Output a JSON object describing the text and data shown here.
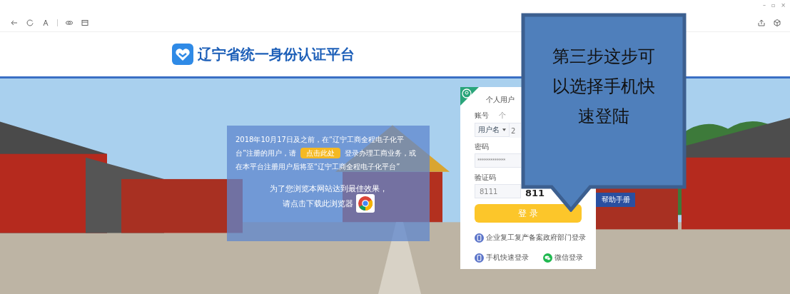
{
  "browser": {
    "window_controls": [
      "–",
      "▫",
      "×"
    ]
  },
  "header": {
    "title": "辽宁省统一身份认证平台"
  },
  "notice": {
    "text_before": "2018年10月17日及之前，在“辽宁工商全程电子化平台”注册的用户，请",
    "link": "点击此处",
    "text_after": "登录办理工商业务，或在本平台注册用户后将至“辽宁工商全程电子化平台”",
    "browser_tip": "为了您浏览本网站达到最佳效果，",
    "download_tip": "请点击下载此浏览器"
  },
  "login": {
    "tabs": [
      {
        "label": "个人用户",
        "selected": true
      }
    ],
    "account_label": "账号",
    "account_hint": "个",
    "account_type": "用户名",
    "username_placeholder": "2",
    "password_label": "密码",
    "password_value": "*************",
    "captcha_label": "验证码",
    "captcha_value": "8111",
    "captcha_image": "811",
    "submit": "登 录",
    "links": [
      {
        "label": "企业复工复产备案政府部门登录",
        "kind": "phone"
      },
      {
        "label": "手机快速登录",
        "kind": "phone"
      },
      {
        "label": "微信登录",
        "kind": "wechat"
      }
    ]
  },
  "help_tab": "帮助手册",
  "callout": {
    "text": "第三步这步可以选择手机快速登陆"
  }
}
